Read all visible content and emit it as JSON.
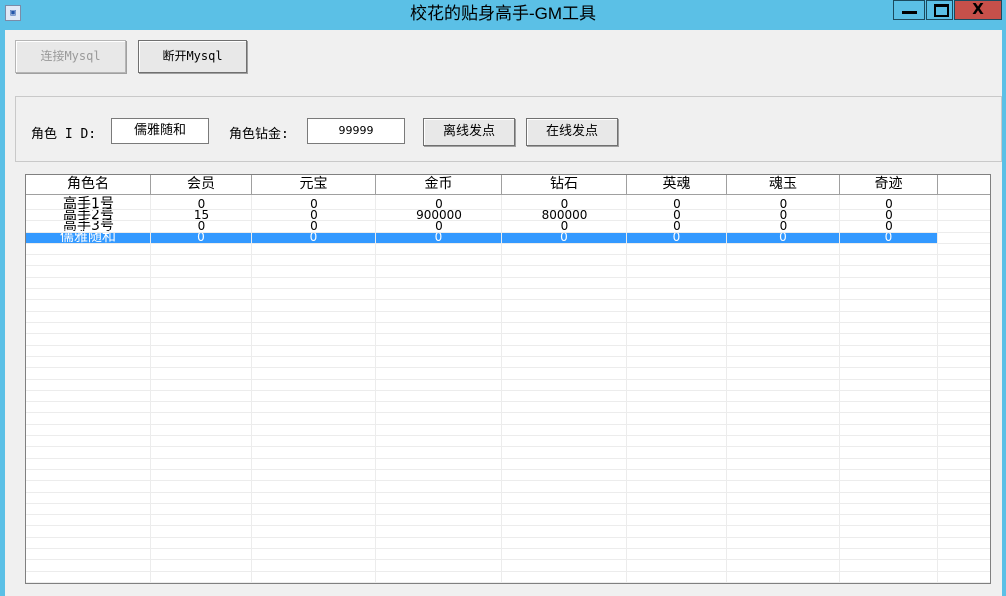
{
  "window": {
    "title": "校花的贴身高手-GM工具",
    "icon": "app-icon",
    "controls": {
      "minimize": "minimize-icon",
      "maximize": "maximize-icon",
      "close_label": "X"
    }
  },
  "toolbar": {
    "connect_label": "连接Mysql",
    "disconnect_label": "断开Mysql"
  },
  "form": {
    "role_id_label": "角色 I D:",
    "role_id_value": "儒雅随和",
    "diamond_label": "角色钻金:",
    "diamond_value": "99999",
    "offline_send_label": "离线发点",
    "online_send_label": "在线发点"
  },
  "table": {
    "columns": [
      "角色名",
      "会员",
      "元宝",
      "金币",
      "钻石",
      "英魂",
      "魂玉",
      "奇迹"
    ],
    "rows": [
      [
        "高手1号",
        "0",
        "0",
        "0",
        "0",
        "0",
        "0",
        "0"
      ],
      [
        "高手2号",
        "15",
        "0",
        "900000",
        "800000",
        "0",
        "0",
        "0"
      ],
      [
        "高手3号",
        "0",
        "0",
        "0",
        "0",
        "0",
        "0",
        "0"
      ],
      [
        "儒雅随和",
        "0",
        "0",
        "0",
        "0",
        "0",
        "0",
        "0"
      ]
    ],
    "selected_row": 3
  },
  "colors": {
    "titlebar": "#5bc0e6",
    "close_button": "#c7504a",
    "selection": "#3399ff"
  }
}
